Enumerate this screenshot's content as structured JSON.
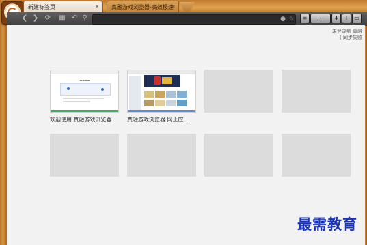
{
  "tabs": [
    {
      "label": "新建标签页",
      "active": true
    },
    {
      "label": "真融游戏浏览器-高效极速",
      "active": false
    }
  ],
  "address": {
    "value": ""
  },
  "login": {
    "line1": "未登录到 真融",
    "line2": "( 同步失败"
  },
  "tiles": [
    {
      "label": "欢迎使用 真融游戏浏览器"
    },
    {
      "label": "真融游戏浏览器 网上应..."
    }
  ],
  "watermark": "最需教育",
  "colors": {
    "frame": "#c98636",
    "toolbar": "#4a4a4a",
    "tile_empty": "#dcdcdc",
    "watermark": "#1832b8"
  }
}
